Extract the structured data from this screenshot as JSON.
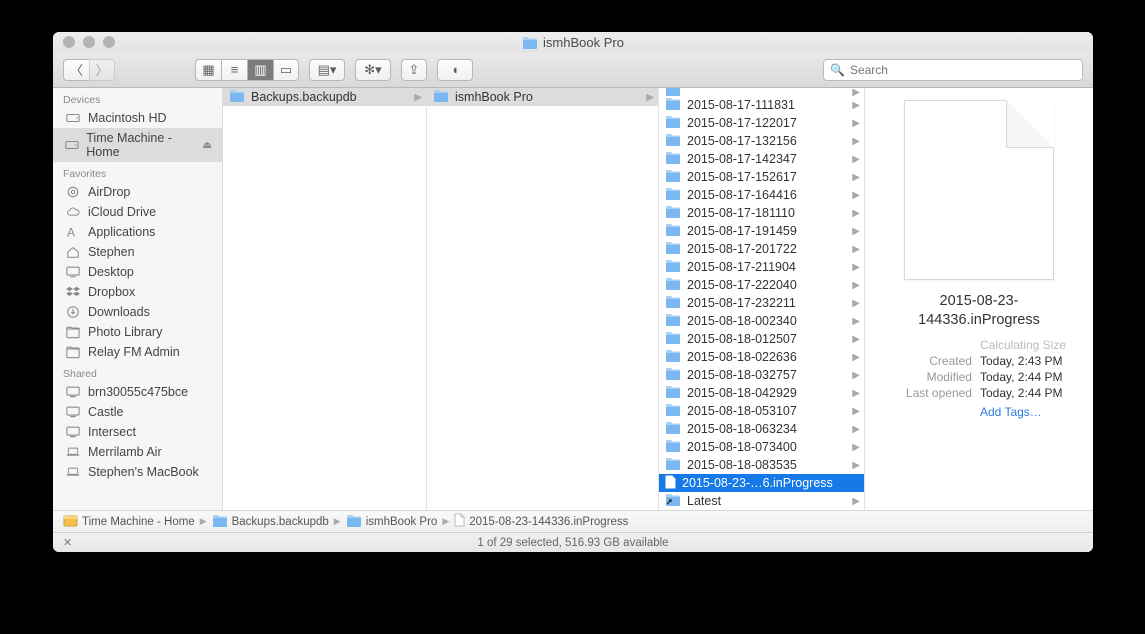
{
  "window": {
    "title": "ismhBook Pro"
  },
  "search": {
    "placeholder": "Search"
  },
  "sidebar": {
    "sections": [
      {
        "title": "Devices",
        "items": [
          {
            "label": "Macintosh HD",
            "icon": "hd"
          },
          {
            "label": "Time Machine - Home",
            "icon": "hd",
            "eject": true,
            "selected": true
          }
        ]
      },
      {
        "title": "Favorites",
        "items": [
          {
            "label": "AirDrop",
            "icon": "airdrop"
          },
          {
            "label": "iCloud Drive",
            "icon": "cloud"
          },
          {
            "label": "Applications",
            "icon": "apps"
          },
          {
            "label": "Stephen",
            "icon": "home"
          },
          {
            "label": "Desktop",
            "icon": "desktop"
          },
          {
            "label": "Dropbox",
            "icon": "dropbox"
          },
          {
            "label": "Downloads",
            "icon": "downloads"
          },
          {
            "label": "Photo Library",
            "icon": "folder"
          },
          {
            "label": "Relay FM Admin",
            "icon": "folder"
          }
        ]
      },
      {
        "title": "Shared",
        "items": [
          {
            "label": "brn30055c475bce",
            "icon": "net"
          },
          {
            "label": "Castle",
            "icon": "net"
          },
          {
            "label": "Intersect",
            "icon": "net"
          },
          {
            "label": "Merrilamb Air",
            "icon": "laptop"
          },
          {
            "label": "Stephen's MacBook",
            "icon": "laptop"
          }
        ]
      }
    ]
  },
  "columns": {
    "col0": [
      {
        "label": "Backups.backupdb",
        "type": "folder",
        "arrow": true,
        "selparent": true
      }
    ],
    "col1": [
      {
        "label": "ismhBook Pro",
        "type": "folder",
        "arrow": true,
        "selparent": true
      }
    ],
    "col2": [
      {
        "label": "2015-08-17-111831",
        "type": "folder",
        "arrow": true
      },
      {
        "label": "2015-08-17-122017",
        "type": "folder",
        "arrow": true
      },
      {
        "label": "2015-08-17-132156",
        "type": "folder",
        "arrow": true
      },
      {
        "label": "2015-08-17-142347",
        "type": "folder",
        "arrow": true
      },
      {
        "label": "2015-08-17-152617",
        "type": "folder",
        "arrow": true
      },
      {
        "label": "2015-08-17-164416",
        "type": "folder",
        "arrow": true
      },
      {
        "label": "2015-08-17-181110",
        "type": "folder",
        "arrow": true
      },
      {
        "label": "2015-08-17-191459",
        "type": "folder",
        "arrow": true
      },
      {
        "label": "2015-08-17-201722",
        "type": "folder",
        "arrow": true
      },
      {
        "label": "2015-08-17-211904",
        "type": "folder",
        "arrow": true
      },
      {
        "label": "2015-08-17-222040",
        "type": "folder",
        "arrow": true
      },
      {
        "label": "2015-08-17-232211",
        "type": "folder",
        "arrow": true
      },
      {
        "label": "2015-08-18-002340",
        "type": "folder",
        "arrow": true
      },
      {
        "label": "2015-08-18-012507",
        "type": "folder",
        "arrow": true
      },
      {
        "label": "2015-08-18-022636",
        "type": "folder",
        "arrow": true
      },
      {
        "label": "2015-08-18-032757",
        "type": "folder",
        "arrow": true
      },
      {
        "label": "2015-08-18-042929",
        "type": "folder",
        "arrow": true
      },
      {
        "label": "2015-08-18-053107",
        "type": "folder",
        "arrow": true
      },
      {
        "label": "2015-08-18-063234",
        "type": "folder",
        "arrow": true
      },
      {
        "label": "2015-08-18-073400",
        "type": "folder",
        "arrow": true
      },
      {
        "label": "2015-08-18-083535",
        "type": "folder",
        "arrow": true
      },
      {
        "label": "2015-08-23-…6.inProgress",
        "type": "file",
        "selected": true
      },
      {
        "label": "Latest",
        "type": "alias",
        "arrow": true
      }
    ]
  },
  "preview": {
    "name": "2015-08-23-144336.inProgress",
    "size_label": "Calculating Size",
    "created_label": "Created",
    "created": "Today, 2:43 PM",
    "modified_label": "Modified",
    "modified": "Today, 2:44 PM",
    "opened_label": "Last opened",
    "opened": "Today, 2:44 PM",
    "addtags": "Add Tags…"
  },
  "pathbar": [
    {
      "label": "Time Machine - Home",
      "icon": "disk"
    },
    {
      "label": "Backups.backupdb",
      "icon": "folder"
    },
    {
      "label": "ismhBook Pro",
      "icon": "folder"
    },
    {
      "label": "2015-08-23-144336.inProgress",
      "icon": "file"
    }
  ],
  "status": {
    "text": "1 of 29 selected, 516.93 GB available"
  }
}
